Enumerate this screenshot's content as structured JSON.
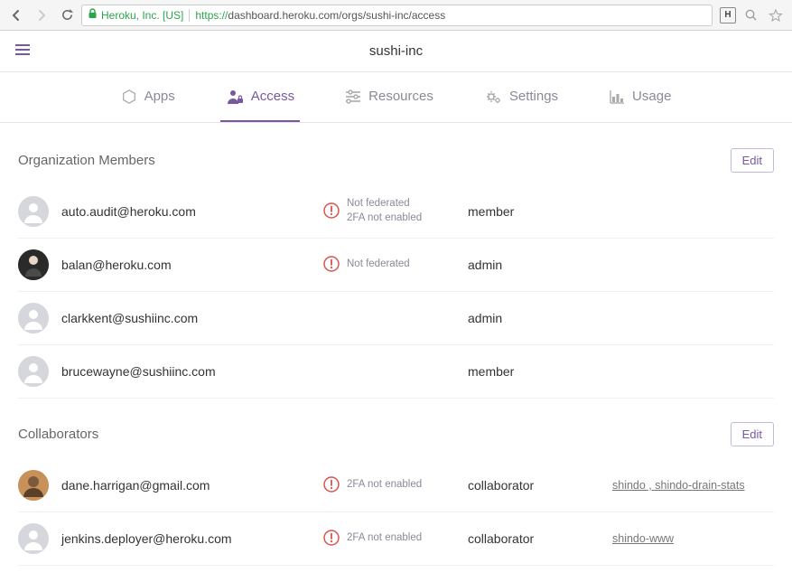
{
  "browser": {
    "identity": "Heroku, Inc. [US]",
    "protocol": "https://",
    "url_rest": "dashboard.heroku.com/orgs/sushi-inc/access"
  },
  "header": {
    "org_name": "sushi-inc"
  },
  "tabs": {
    "apps": "Apps",
    "access": "Access",
    "resources": "Resources",
    "settings": "Settings",
    "usage": "Usage"
  },
  "sections": {
    "members": {
      "title": "Organization Members",
      "edit_label": "Edit",
      "rows": [
        {
          "email": "auto.audit@heroku.com",
          "warn1": "Not federated",
          "warn2": "2FA not enabled",
          "role": "member",
          "avatar": "default"
        },
        {
          "email": "balan@heroku.com",
          "warn1": "Not federated",
          "warn2": "",
          "role": "admin",
          "avatar": "dark"
        },
        {
          "email": "clarkkent@sushiinc.com",
          "warn1": "",
          "warn2": "",
          "role": "admin",
          "avatar": "default"
        },
        {
          "email": "brucewayne@sushiinc.com",
          "warn1": "",
          "warn2": "",
          "role": "member",
          "avatar": "default"
        }
      ]
    },
    "collaborators": {
      "title": "Collaborators",
      "edit_label": "Edit",
      "rows": [
        {
          "email": "dane.harrigan@gmail.com",
          "warn1": "2FA not enabled",
          "role": "collaborator",
          "apps": "shindo , shindo-drain-stats",
          "avatar": "photo"
        },
        {
          "email": "jenkins.deployer@heroku.com",
          "warn1": "2FA not enabled",
          "role": "collaborator",
          "apps": "shindo-www",
          "avatar": "default"
        }
      ]
    }
  }
}
